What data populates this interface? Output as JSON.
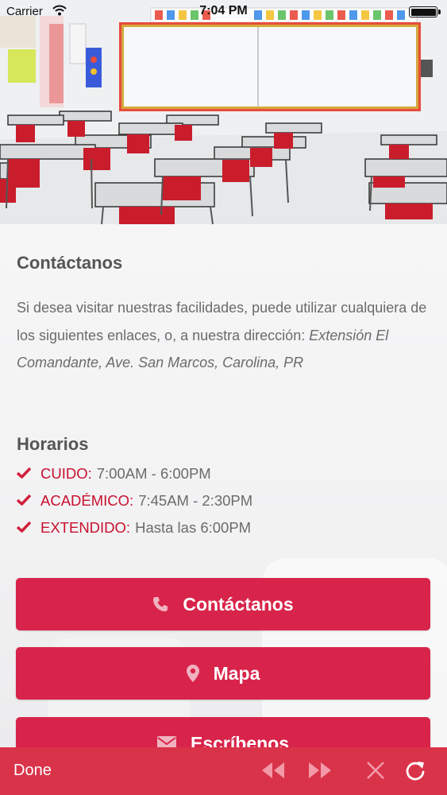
{
  "status_bar": {
    "carrier": "Carrier",
    "time": "7:04 PM"
  },
  "hero": {
    "icon": "classroom-photo"
  },
  "contact": {
    "title": "Contáctanos",
    "intro_text": "Si desea visitar nuestras facilidades, puede utilizar cualquiera de los siguientes enlaces, o, a nuestra dirección: ",
    "address": "Extensión El Comandante, Ave. San Marcos, Carolina, PR"
  },
  "hours": {
    "title": "Horarios",
    "items": [
      {
        "label": "CUIDO:",
        "value": "7:00AM - 6:00PM"
      },
      {
        "label": "ACADÉMICO:",
        "value": "7:45AM - 2:30PM"
      },
      {
        "label": "EXTENDIDO:",
        "value": "Hasta las 6:00PM"
      }
    ]
  },
  "buttons": {
    "contact": {
      "label": "Contáctanos",
      "icon": "phone-icon"
    },
    "map": {
      "label": "Mapa",
      "icon": "map-pin-icon"
    },
    "write": {
      "label": "Escríbenos",
      "icon": "envelope-icon"
    }
  },
  "toolbar": {
    "done_label": "Done"
  },
  "colors": {
    "accent": "#d8244a",
    "toolbar": "#d9334a",
    "label_red": "#c8102e",
    "text_gray": "#6b6b6b"
  }
}
